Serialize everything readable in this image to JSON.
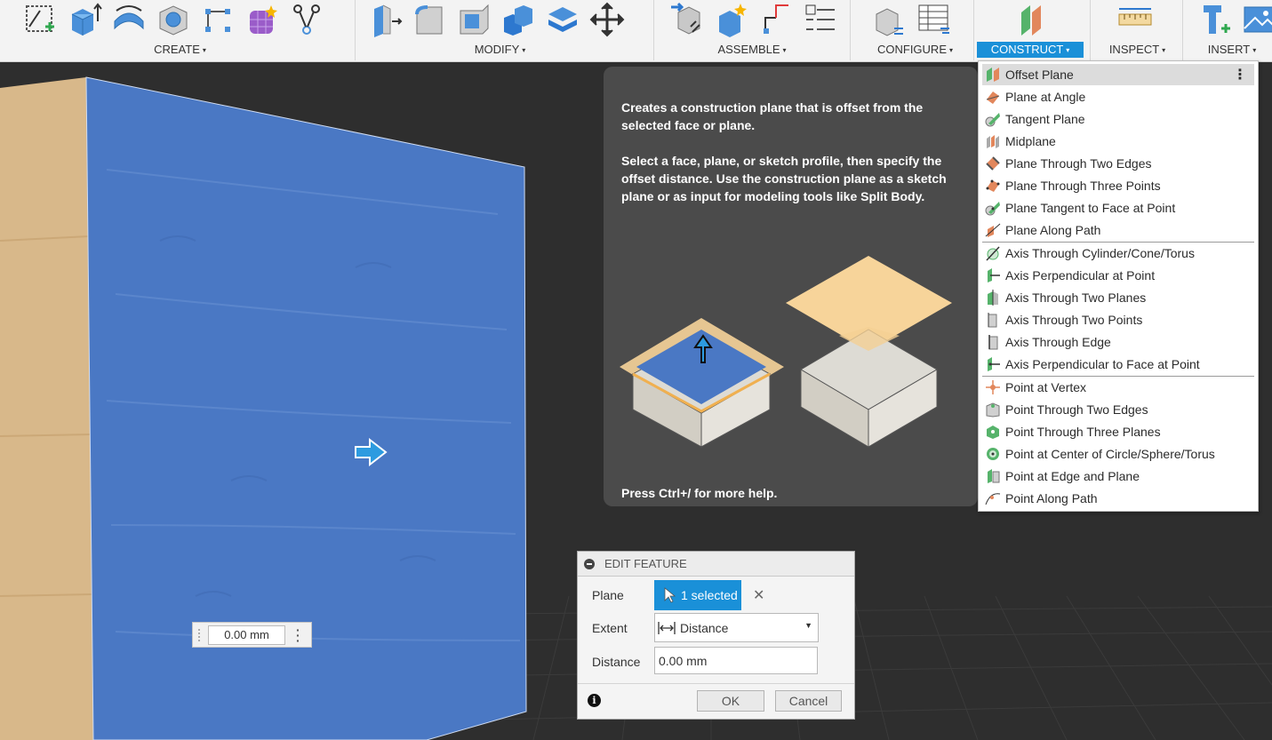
{
  "toolbar": {
    "groups": {
      "create": {
        "label": "CREATE"
      },
      "modify": {
        "label": "MODIFY"
      },
      "assemble": {
        "label": "ASSEMBLE"
      },
      "configure": {
        "label": "CONFIGURE"
      },
      "construct": {
        "label": "CONSTRUCT"
      },
      "inspect": {
        "label": "INSPECT"
      },
      "insert": {
        "label": "INSERT"
      }
    },
    "caret": "▾",
    "active_color": "#1a90d8"
  },
  "tooltip": {
    "description": "Creates a construction plane that is offset from the selected face or plane.",
    "instructions": "Select a face, plane, or sketch profile, then specify the offset distance. Use the construction plane as a sketch plane or as input for modeling tools like Split Body.",
    "help": "Press Ctrl+/ for more help."
  },
  "construct_menu": {
    "items": [
      {
        "label": "Offset Plane",
        "icon": "offset-plane-icon"
      },
      {
        "label": "Plane at Angle",
        "icon": "plane-at-angle-icon"
      },
      {
        "label": "Tangent Plane",
        "icon": "tangent-plane-icon"
      },
      {
        "label": "Midplane",
        "icon": "midplane-icon"
      },
      {
        "label": "Plane Through Two Edges",
        "icon": "plane-two-edges-icon"
      },
      {
        "label": "Plane Through Three Points",
        "icon": "plane-three-points-icon"
      },
      {
        "label": "Plane Tangent to Face at Point",
        "icon": "plane-tangent-face-icon"
      },
      {
        "label": "Plane Along Path",
        "icon": "plane-along-path-icon"
      },
      {
        "label": "Axis Through Cylinder/Cone/Torus",
        "icon": "axis-cylinder-icon"
      },
      {
        "label": "Axis Perpendicular at Point",
        "icon": "axis-perpendicular-point-icon"
      },
      {
        "label": "Axis Through Two Planes",
        "icon": "axis-two-planes-icon"
      },
      {
        "label": "Axis Through Two Points",
        "icon": "axis-two-points-icon"
      },
      {
        "label": "Axis Through Edge",
        "icon": "axis-edge-icon"
      },
      {
        "label": "Axis Perpendicular to Face at Point",
        "icon": "axis-perpendicular-face-icon"
      },
      {
        "label": "Point at Vertex",
        "icon": "point-vertex-icon"
      },
      {
        "label": "Point Through Two Edges",
        "icon": "point-two-edges-icon"
      },
      {
        "label": "Point Through Three Planes",
        "icon": "point-three-planes-icon"
      },
      {
        "label": "Point at Center of Circle/Sphere/Torus",
        "icon": "point-center-icon"
      },
      {
        "label": "Point at Edge and Plane",
        "icon": "point-edge-plane-icon"
      },
      {
        "label": "Point Along Path",
        "icon": "point-along-path-icon"
      }
    ],
    "more_glyph": "⋮"
  },
  "edit_feature": {
    "title": "EDIT FEATURE",
    "plane_label": "Plane",
    "plane_value": "1 selected",
    "clear_glyph": "✕",
    "extent_label": "Extent",
    "extent_value": "Distance",
    "distance_label": "Distance",
    "distance_value": "0.00 mm",
    "ok_label": "OK",
    "cancel_label": "Cancel",
    "info_glyph": "i"
  },
  "canvas": {
    "distance_input": "0.00 mm",
    "face_color": "#4a78c4",
    "wood_color": "#d8b88a"
  }
}
